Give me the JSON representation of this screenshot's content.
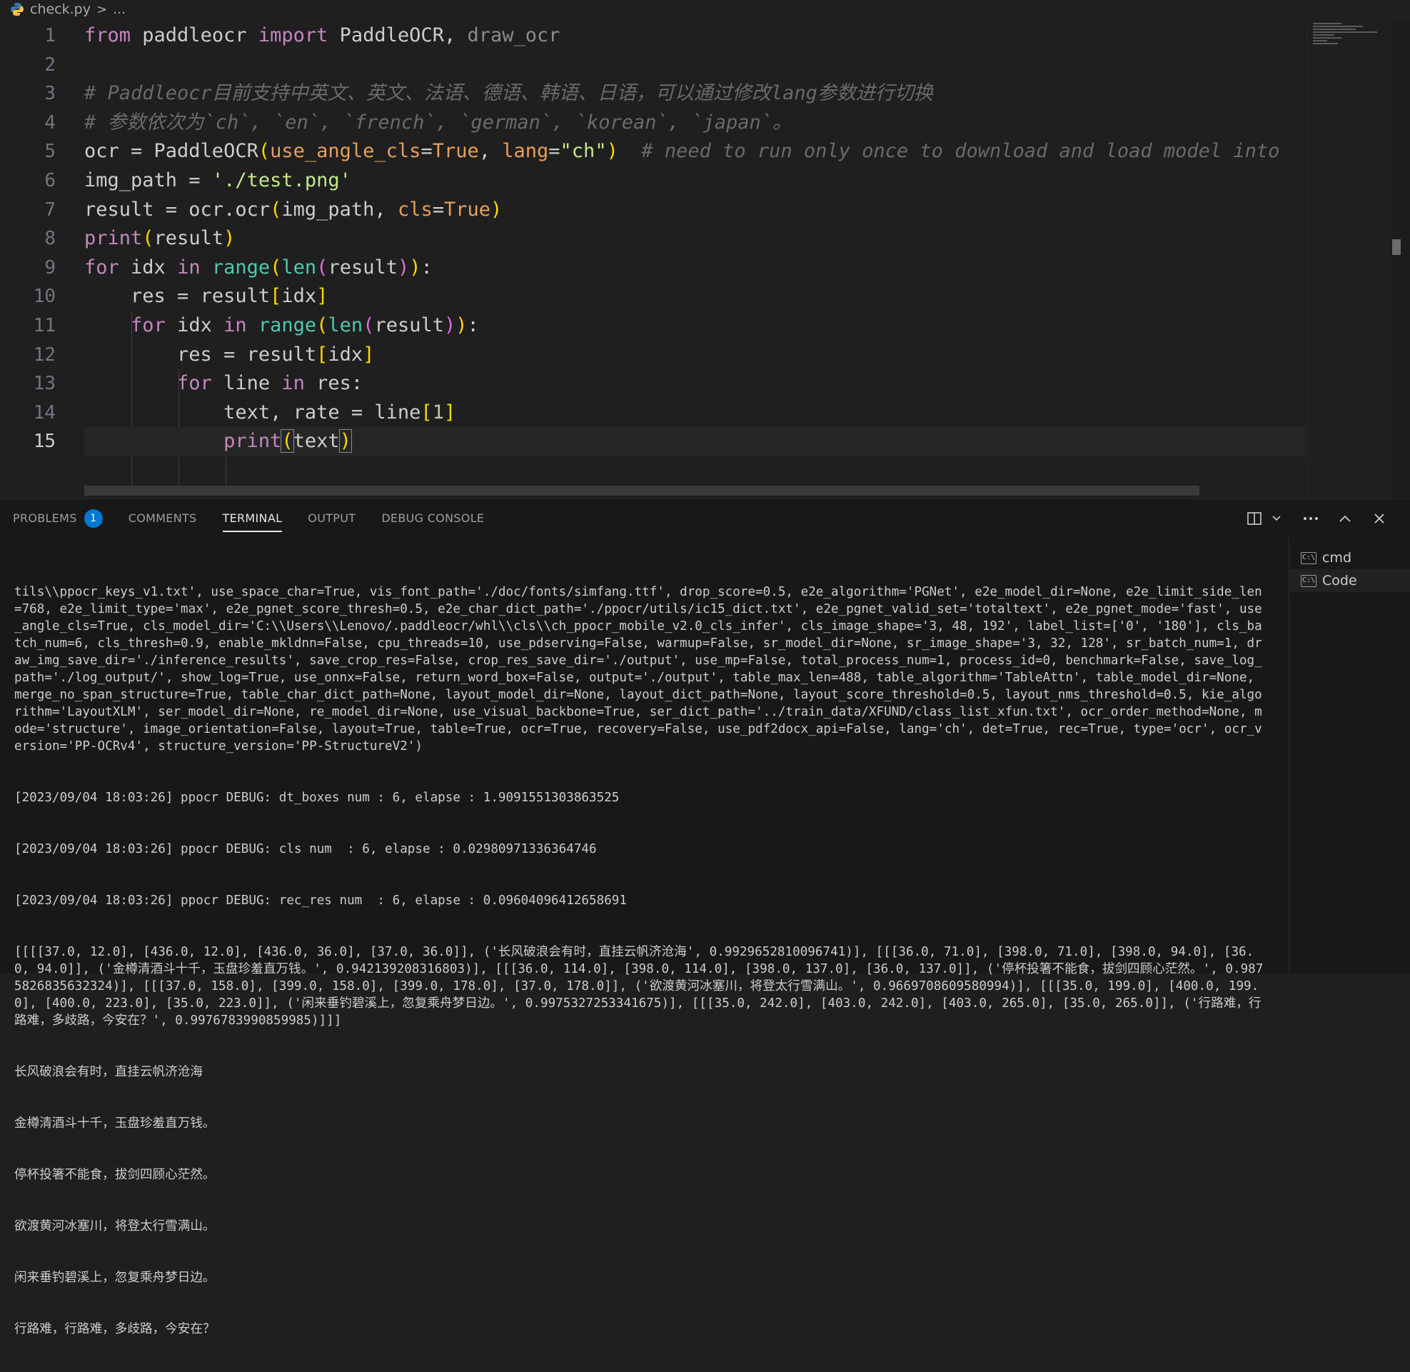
{
  "breadcrumb": {
    "file": "check.py",
    "rest": "..."
  },
  "editor": {
    "line_numbers": [
      "1",
      "2",
      "3",
      "4",
      "5",
      "6",
      "7",
      "8",
      "9",
      "10",
      "11",
      "12",
      "13",
      "14",
      "15"
    ],
    "active_line": "15"
  },
  "code": {
    "l1": {
      "from": "from",
      "mod": " paddleocr ",
      "import": "import",
      "names": " PaddleOCR, ",
      "draw": "draw_ocr"
    },
    "l3": "# Paddleocr目前支持中英文、英文、法语、德语、韩语、日语，可以通过修改lang参数进行切换",
    "l4": "# 参数依次为`ch`, `en`, `french`, `german`, `korean`, `japan`。",
    "l5": {
      "a": "ocr = PaddleOCR",
      "p1": "use_angle_cls",
      "eq1": "=",
      "t1": "True",
      "c": ", ",
      "p2": "lang",
      "eq2": "=",
      "s": "\"ch\"",
      "cm": "  # need to run only once to download and load model into"
    },
    "l6": {
      "a": "img_path = ",
      "s": "'./test.png'"
    },
    "l7": {
      "a": "result = ocr.",
      "fn": "ocr",
      "b": "img_path, ",
      "p": "cls",
      "eq": "=",
      "t": "True"
    },
    "l8": {
      "fn": "print",
      "b": "result"
    },
    "l9": {
      "kw": "for",
      "a": " idx ",
      "in": "in",
      "sp": " ",
      "range": "range",
      "len": "len",
      "b": "result",
      "end": ":"
    },
    "l10": {
      "a": "res = result",
      "b": "idx"
    },
    "l11": {
      "kw": "for",
      "a": " idx ",
      "in": "in",
      "sp": " ",
      "range": "range",
      "len": "len",
      "b": "result",
      "end": ":"
    },
    "l12": {
      "a": "res = result",
      "b": "idx"
    },
    "l13": {
      "kw": "for",
      "a": " line ",
      "in": "in",
      "b": " res:"
    },
    "l14": {
      "a": "text, rate = line",
      "n": "1"
    },
    "l15": {
      "fn": "print",
      "b": "text"
    }
  },
  "panel": {
    "tabs": [
      "PROBLEMS",
      "COMMENTS",
      "TERMINAL",
      "OUTPUT",
      "DEBUG CONSOLE"
    ],
    "problems_count": "1",
    "terminals": [
      "cmd",
      "Code"
    ]
  },
  "terminal": {
    "lines": [
      "tils\\\\ppocr_keys_v1.txt', use_space_char=True, vis_font_path='./doc/fonts/simfang.ttf', drop_score=0.5, e2e_algorithm='PGNet', e2e_model_dir=None, e2e_limit_side_len=768, e2e_limit_type='max', e2e_pgnet_score_thresh=0.5, e2e_char_dict_path='./ppocr/utils/ic15_dict.txt', e2e_pgnet_valid_set='totaltext', e2e_pgnet_mode='fast', use_angle_cls=True, cls_model_dir='C:\\\\Users\\\\Lenovo/.paddleocr/whl\\\\cls\\\\ch_ppocr_mobile_v2.0_cls_infer', cls_image_shape='3, 48, 192', label_list=['0', '180'], cls_batch_num=6, cls_thresh=0.9, enable_mkldnn=False, cpu_threads=10, use_pdserving=False, warmup=False, sr_model_dir=None, sr_image_shape='3, 32, 128', sr_batch_num=1, draw_img_save_dir='./inference_results', save_crop_res=False, crop_res_save_dir='./output', use_mp=False, total_process_num=1, process_id=0, benchmark=False, save_log_path='./log_output/', show_log=True, use_onnx=False, return_word_box=False, output='./output', table_max_len=488, table_algorithm='TableAttn', table_model_dir=None, merge_no_span_structure=True, table_char_dict_path=None, layout_model_dir=None, layout_dict_path=None, layout_score_threshold=0.5, layout_nms_threshold=0.5, kie_algorithm='LayoutXLM', ser_model_dir=None, re_model_dir=None, use_visual_backbone=True, ser_dict_path='../train_data/XFUND/class_list_xfun.txt', ocr_order_method=None, mode='structure', image_orientation=False, layout=True, table=True, ocr=True, recovery=False, use_pdf2docx_api=False, lang='ch', det=True, rec=True, type='ocr', ocr_version='PP-OCRv4', structure_version='PP-StructureV2')",
      "[2023/09/04 18:03:26] ppocr DEBUG: dt_boxes num : 6, elapse : 1.9091551303863525",
      "[2023/09/04 18:03:26] ppocr DEBUG: cls num  : 6, elapse : 0.02980971336364746",
      "[2023/09/04 18:03:26] ppocr DEBUG: rec_res num  : 6, elapse : 0.09604096412658691",
      "[[[[37.0, 12.0], [436.0, 12.0], [436.0, 36.0], [37.0, 36.0]], ('长风破浪会有时，直挂云帆济沧海', 0.9929652810096741)], [[[36.0, 71.0], [398.0, 71.0], [398.0, 94.0], [36.0, 94.0]], ('金樽清酒斗十千，玉盘珍羞直万钱。', 0.942139208316803)], [[[36.0, 114.0], [398.0, 114.0], [398.0, 137.0], [36.0, 137.0]], ('停杯投箸不能食，拔剑四顾心茫然。', 0.9875826835632324)], [[[37.0, 158.0], [399.0, 158.0], [399.0, 178.0], [37.0, 178.0]], ('欲渡黄河冰塞川，将登太行雪满山。', 0.9669708609580994)], [[[35.0, 199.0], [400.0, 199.0], [400.0, 223.0], [35.0, 223.0]], ('闲来垂钓碧溪上，忽复乘舟梦日边。', 0.9975327253341675)], [[[35.0, 242.0], [403.0, 242.0], [403.0, 265.0], [35.0, 265.0]], ('行路难，行路难，多歧路，今安在？', 0.9976783990859985)]]]",
      "长风破浪会有时，直挂云帆济沧海",
      "金樽清酒斗十千，玉盘珍羞直万钱。",
      "停杯投箸不能食，拔剑四顾心茫然。",
      "欲渡黄河冰塞川，将登太行雪满山。",
      "闲来垂钓碧溪上，忽复乘舟梦日边。",
      "行路难，行路难，多歧路，今安在？"
    ]
  }
}
